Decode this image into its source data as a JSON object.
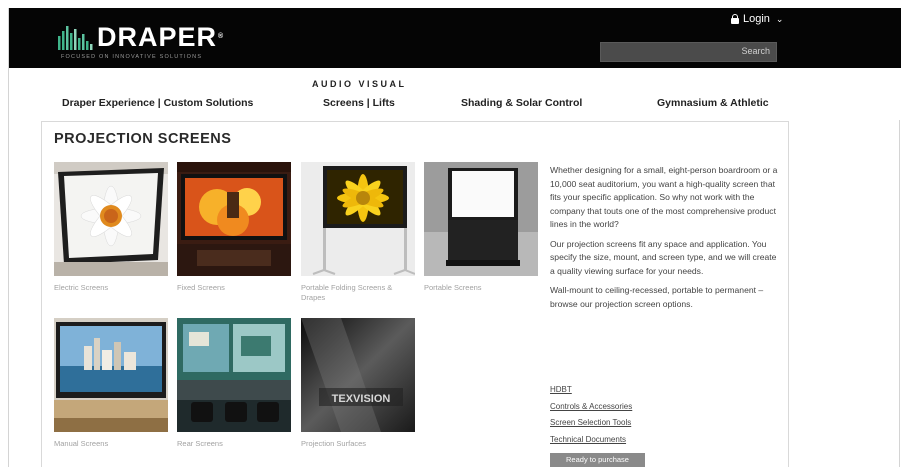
{
  "header": {
    "logo_text": "DRAPER",
    "logo_tm": "®",
    "logo_tagline": "FOCUSED ON INNOVATIVE SOLUTIONS",
    "login_label": "Login",
    "search_label": "Search"
  },
  "nav": {
    "kicker": "AUDIO VISUAL",
    "items": [
      {
        "label": "Draper Experience | Custom Solutions"
      },
      {
        "label": "Screens | Lifts"
      },
      {
        "label": "Shading & Solar Control"
      },
      {
        "label": "Gymnasium & Athletic"
      }
    ]
  },
  "main": {
    "title": "PROJECTION SCREENS",
    "tiles": [
      {
        "caption": "Electric Screens",
        "icon": "electric-screen-image"
      },
      {
        "caption": "Fixed Screens",
        "icon": "fixed-screen-image"
      },
      {
        "caption": "Portable Folding Screens & Drapes",
        "icon": "folding-screen-image"
      },
      {
        "caption": "Portable Screens",
        "icon": "portable-screen-image"
      },
      {
        "caption": "Manual Screens",
        "icon": "manual-screen-image"
      },
      {
        "caption": "Rear Screens",
        "icon": "rear-screen-image"
      },
      {
        "caption": "Projection Surfaces",
        "icon": "projection-surfaces-image"
      }
    ],
    "paragraphs": [
      "Whether designing for a small, eight-person boardroom or a 10,000 seat auditorium, you want a high-quality screen that fits your specific application. So why not work with the company that touts one of the most comprehensive product lines in the world?",
      "Our projection screens fit any space and application. You specify the size, mount, and screen type, and we will create a quality viewing surface for your needs.",
      "Wall-mount to ceiling-recessed, portable to permanent – browse our projection screen options."
    ],
    "links": [
      {
        "label": "HDBT"
      },
      {
        "label": "Controls & Accessories"
      },
      {
        "label": "Screen Selection Tools"
      },
      {
        "label": "Technical Documents"
      }
    ],
    "ready_label": "Ready to purchase",
    "texvision_text": "TEXVISION"
  },
  "colors": {
    "header_bg": "#050505",
    "logo_bars": "#3fb48a",
    "button_gray": "#8a8a8a"
  }
}
